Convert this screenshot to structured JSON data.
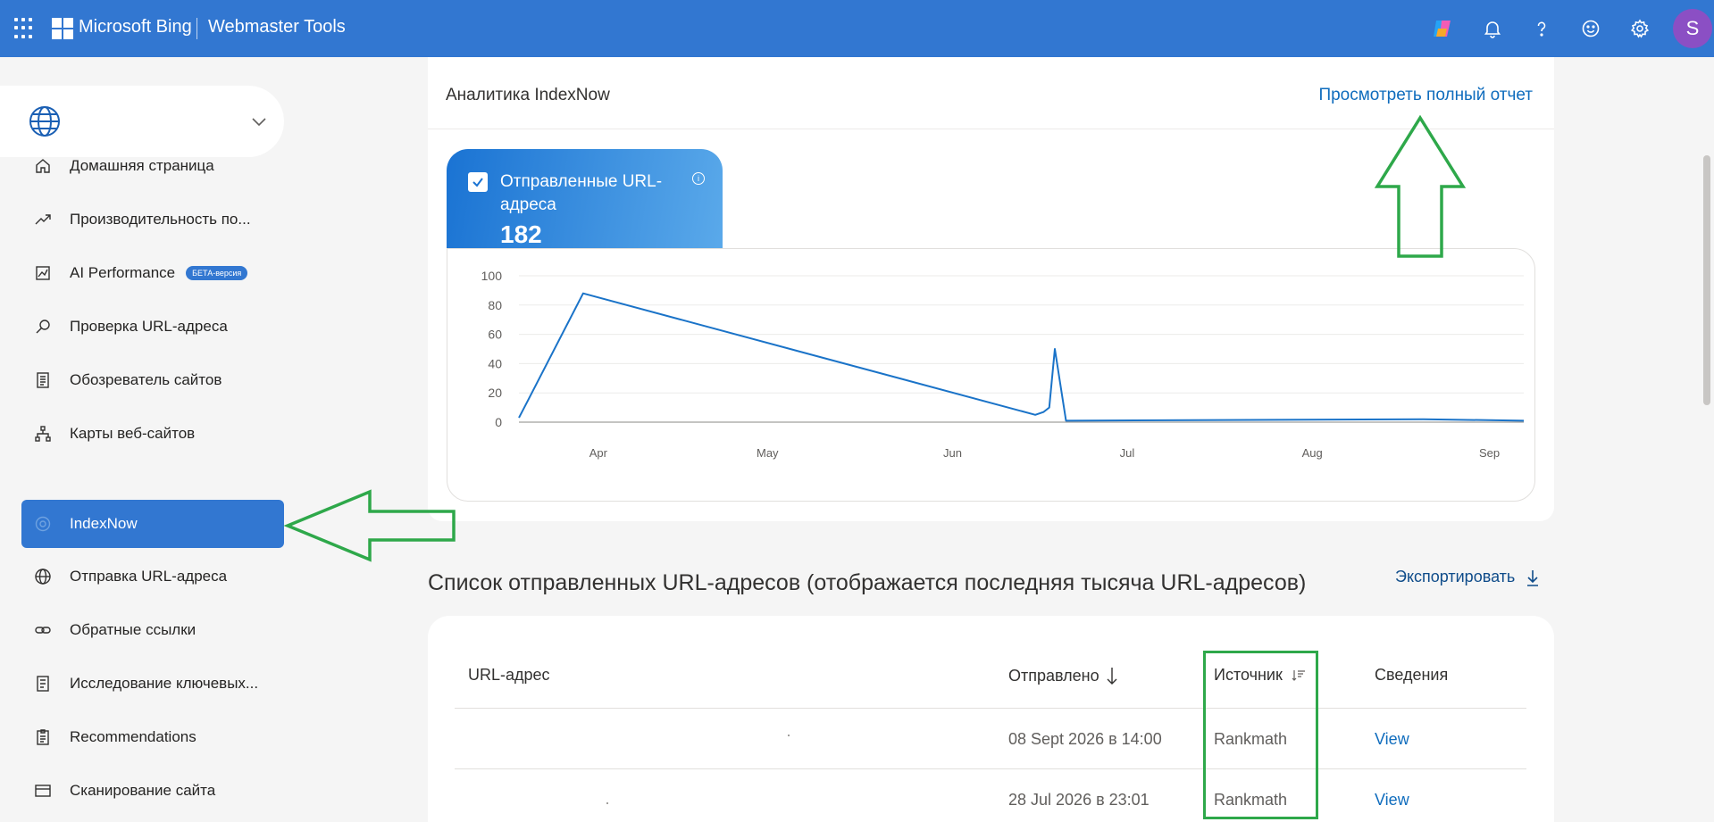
{
  "topbar": {
    "brand": "Microsoft Bing",
    "product": "Webmaster Tools",
    "avatar_letter": "S",
    "icons": [
      "copilot-icon",
      "bell-icon",
      "help-icon",
      "feedback-smiley-icon",
      "gear-icon"
    ]
  },
  "sidebar": {
    "items": [
      {
        "label": "Домашняя страница",
        "icon": "home-icon"
      },
      {
        "label": "Производительность по...",
        "icon": "trend-icon"
      },
      {
        "label": "AI Performance",
        "icon": "ai-chart-icon",
        "badge": "БЕТА-версия"
      },
      {
        "label": "Проверка URL-адреса",
        "icon": "search-icon"
      },
      {
        "label": "Обозреватель сайтов",
        "icon": "document-list-icon"
      },
      {
        "label": "Карты веб-сайтов",
        "icon": "sitemap-icon"
      },
      {
        "label": "IndexNow",
        "icon": "gear-icon",
        "active": true
      },
      {
        "label": "Отправка URL-адреса",
        "icon": "globe-icon"
      },
      {
        "label": "Обратные ссылки",
        "icon": "link-icon"
      },
      {
        "label": "Исследование ключевых...",
        "icon": "notebook-icon"
      },
      {
        "label": "Recommendations",
        "icon": "clipboard-icon"
      },
      {
        "label": "Сканирование сайта",
        "icon": "scan-icon"
      }
    ]
  },
  "analytics": {
    "title": "Аналитика IndexNow",
    "full_report": "Просмотреть полный отчет",
    "tile_label": "Отправленные URL-адреса",
    "tile_value": "182"
  },
  "chart_data": {
    "type": "line",
    "title": "",
    "xlabel": "",
    "ylabel": "",
    "ylim": [
      0,
      100
    ],
    "yticks": [
      "0",
      "20",
      "40",
      "60",
      "80",
      "100"
    ],
    "xticks": [
      "Apr",
      "May",
      "Jun",
      "Jul",
      "Aug",
      "Sep"
    ],
    "series": [
      {
        "x": [
          0,
          1.5,
          11.5,
          92.5,
          94,
          95,
          96,
          98,
          162,
          180
        ],
        "y": [
          3,
          14,
          88,
          5,
          7,
          10,
          50,
          1,
          2,
          1
        ]
      }
    ],
    "grid": true,
    "color": "#1a73c8"
  },
  "list": {
    "title": "Список отправленных URL-адресов (отображается последняя тысяча URL-адресов)",
    "export": "Экспортировать",
    "columns": [
      "URL-адрес",
      "Отправлено",
      "Источник",
      "Сведения"
    ],
    "rows": [
      {
        "submitted": "08 Sept 2026 в 14:00",
        "source": "Rankmath",
        "details": "View"
      },
      {
        "submitted": "28 Jul 2026 в 23:01",
        "source": "Rankmath",
        "details": "View"
      }
    ]
  },
  "annotations": {
    "color": "#2ea84a"
  }
}
